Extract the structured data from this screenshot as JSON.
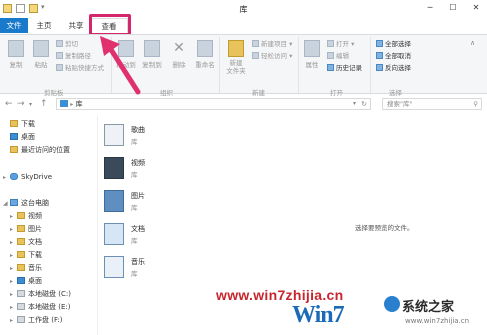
{
  "window": {
    "title": "库"
  },
  "tabs": {
    "file": "文件",
    "home": "主页",
    "share": "共享",
    "view": "查看"
  },
  "ribbon": {
    "clipboard": {
      "copy": "复制",
      "paste": "粘贴",
      "cut": "剪切",
      "copy_path": "复制路径",
      "paste_shortcut": "粘贴快捷方式",
      "group": "剪贴板"
    },
    "organize": {
      "move_to": "移动到",
      "copy_to": "复制到",
      "delete": "删除",
      "rename": "重命名",
      "group": "组织"
    },
    "new": {
      "new_folder": "新建\n文件夹",
      "new_item": "新建项目 ▾",
      "easy_access": "轻松访问 ▾",
      "group": "新建"
    },
    "open": {
      "properties": "属性",
      "open": "打开 ▾",
      "edit": "编辑",
      "history": "历史记录",
      "group": "打开"
    },
    "select": {
      "select_all": "全部选择",
      "select_none": "全部取消",
      "invert": "反向选择",
      "group": "选择"
    }
  },
  "address": {
    "path": "库",
    "search_placeholder": "搜索\"库\""
  },
  "nav": {
    "favorites": [
      "下载",
      "桌面",
      "最近访问的位置"
    ],
    "skydrive": "SkyDrive",
    "this_pc": "这台电脑",
    "pc_items": [
      "视频",
      "图片",
      "文档",
      "下载",
      "音乐",
      "桌面",
      "本地磁盘 (C:)",
      "本地磁盘 (E:)",
      "工作盘 (F:)"
    ]
  },
  "libraries": [
    {
      "name": "歌曲",
      "type": "库"
    },
    {
      "name": "视频",
      "type": "库"
    },
    {
      "name": "图片",
      "type": "库"
    },
    {
      "name": "文档",
      "type": "库"
    },
    {
      "name": "音乐",
      "type": "库"
    }
  ],
  "preview_text": "选择要预览的文件。",
  "watermark": {
    "site": "www.win7zhijia.cn",
    "logo": "Win7",
    "name": "系统之家",
    "url": "www.win7zhijia.cn"
  },
  "colors": {
    "file_tab": "#1979ca",
    "highlight": "#d4266b",
    "arrow": "#e0306e"
  }
}
